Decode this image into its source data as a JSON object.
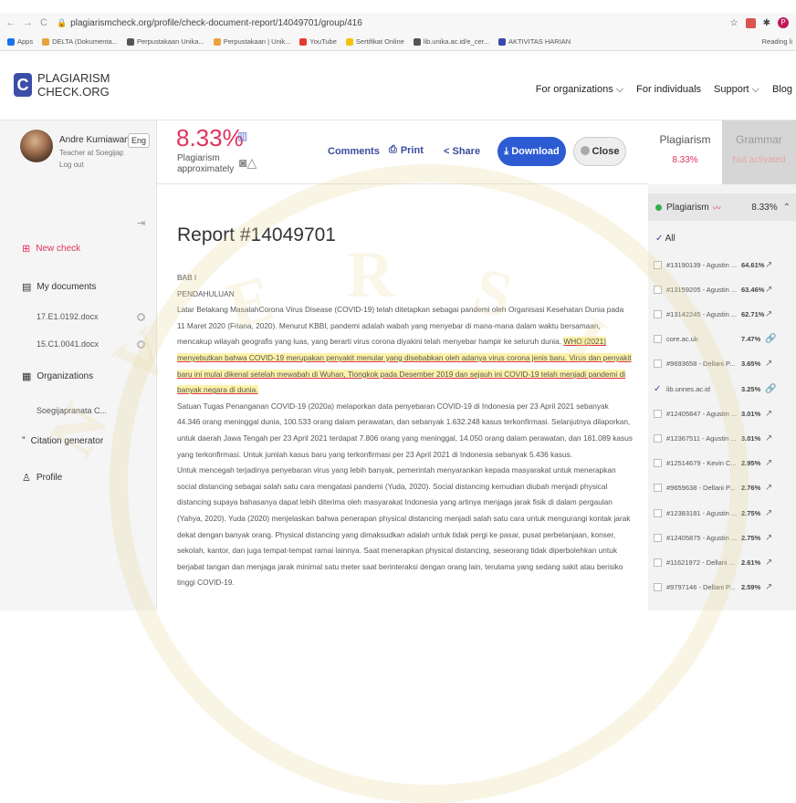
{
  "browser": {
    "url": "plagiarismcheck.org/profile/check-document-report/14049701/group/416",
    "nav_back": "←",
    "nav_forward": "→",
    "nav_reload": "C",
    "bookmarks": [
      "Apps",
      "DELTA (Dokumenta...",
      "Perpustakaan Unika...",
      "Perpustakaan | Unik...",
      "YouTube",
      "Sertifikat Online",
      "lib.unika.ac.id/e_cer...",
      "AKTIVITAS HARIAN"
    ],
    "reading_list": "Reading li"
  },
  "site": {
    "logo_line1": "PLAGIARISM",
    "logo_line2": "CHECK.ORG",
    "logo_letter": "C",
    "nav": [
      "For organizations ⌵",
      "For individuals",
      "Support ⌵",
      "Blog"
    ]
  },
  "user": {
    "name": "Andre Kurniawan",
    "role": "Teacher at Soegijapra...",
    "logout": "Log out",
    "lang": "Eng"
  },
  "score": {
    "value": "8.33%",
    "label_line1": "Plagiarism",
    "label_line2": "approximately"
  },
  "actions": {
    "comments": "Comments",
    "print": "Print",
    "share": "Share",
    "download": "Download",
    "close": "Close"
  },
  "tabs": {
    "plagiarism": "Plagiarism",
    "plagiarism_value": "8.33%",
    "grammar": "Grammar",
    "grammar_value": "Not activated"
  },
  "sidebar": {
    "collapse": "⇥",
    "new_check": "New check",
    "my_documents": "My documents",
    "docs": [
      {
        "name": "17.E1.0192.docx"
      },
      {
        "name": "15.C1.0041.docx"
      }
    ],
    "organizations": "Organizations",
    "org_name": "Soegijapranata C...",
    "citation": "Citation generator",
    "profile": "Profile"
  },
  "report": {
    "title": "Report #14049701",
    "bab": "BAB I",
    "section": "PENDAHULUAN",
    "p1": "Latar Belakang MasalahCorona Virus Disease (COVID-19) telah ditetapkan sebagai pandemi oleh Organisasi Kesehatan Dunia pada 11 Maret 2020 (Friana, 2020). Menurut KBBI, pandemi adalah wabah yang menyebar di mana-mana dalam waktu bersamaan, mencakup wilayah geografis yang luas, yang berarti virus corona diyakini telah menyebar hampir ke seluruh dunia.",
    "p1_hl": "WHO (2021) menyebutkan bahwa COVID-19 merupakan penyakit menular yang disebabkan oleh adanya virus corona jenis baru. Virus dan penyakit baru ini mulai dikenal setelah mewabah di Wuhan, Tiongkok pada Desember 2019 dan sejauh ini COVID-19 telah menjadi pandemi di banyak negara di dunia.",
    "p2": "Satuan Tugas Penanganan COVID-19 (2020a) melaporkan data penyebaran COVID-19 di Indonesia per 23 April 2021 sebanyak 44.346 orang meninggal dunia, 100.533 orang dalam perawatan, dan sebanyak 1.632.248 kasus terkonfirmasi. Selanjutnya dilaporkan, untuk daerah Jawa Tengah per 23 April 2021 terdapat 7.806 orang yang meninggal, 14.050 orang dalam perawatan, dan 181.089 kasus yang terkonfirmasi. Untuk jumlah kasus baru yang terkonfirmasi per 23 April 2021 di Indonesia sebanyak 5.436 kasus.",
    "p3": "Untuk mencegah terjadinya penyebaran virus yang lebih banyak, pemerintah menyarankan kepada masyarakat untuk menerapkan social distancing sebagai salah satu cara mengatasi pandemi (Yuda, 2020). Social distancing kemudian diubah menjadi physical distancing supaya bahasanya dapat lebih diterima oleh masyarakat Indonesia yang artinya menjaga jarak fisik di dalam pergaulan (Yahya, 2020). Yuda (2020) menjelaskan bahwa penerapan physical distancing menjadi salah satu cara untuk mengurangi kontak jarak dekat dengan banyak orang. Physical distancing yang dimaksudkan adalah untuk tidak pergi ke pasar, pusat perbelanjaan, konser, sekolah, kantor, dan juga tempat-tempat ramai lainnya. Saat menerapkan physical distancing, seseorang tidak diperbolehkan untuk berjabat tangan dan menjaga jarak minimal satu meter saat berinteraksi dengan orang lain, terutama yang sedang sakit atau berisiko tinggi COVID-19."
  },
  "panel": {
    "header_label": "Plagiarism",
    "header_value": "8.33%",
    "all_label": "All",
    "sources": [
      {
        "name": "#13190139 - Agustin ...",
        "pct": "64.61%",
        "checked": false,
        "link": "↗"
      },
      {
        "name": "#13159205 - Agustin ...",
        "pct": "63.46%",
        "checked": false,
        "link": "↗"
      },
      {
        "name": "#13142245 - Agustin ...",
        "pct": "62.71%",
        "checked": false,
        "link": "↗"
      },
      {
        "name": "core.ac.uk",
        "pct": "7.47%",
        "checked": false,
        "link": "🔗"
      },
      {
        "name": "#9693658 - Dellani P...",
        "pct": "3.65%",
        "checked": false,
        "link": "↗"
      },
      {
        "name": "lib.unnes.ac.id",
        "pct": "3.25%",
        "checked": true,
        "link": "🔗"
      },
      {
        "name": "#12405847 - Agustin ...",
        "pct": "3.01%",
        "checked": false,
        "link": "↗"
      },
      {
        "name": "#12367511 - Agustin ...",
        "pct": "3.01%",
        "checked": false,
        "link": "↗"
      },
      {
        "name": "#12514679 - Kevin C...",
        "pct": "2.95%",
        "checked": false,
        "link": "↗"
      },
      {
        "name": "#9659638 - Dellani P...",
        "pct": "2.76%",
        "checked": false,
        "link": "↗"
      },
      {
        "name": "#12383181 - Agustin ...",
        "pct": "2.75%",
        "checked": false,
        "link": "↗"
      },
      {
        "name": "#12405875 - Agustin ...",
        "pct": "2.75%",
        "checked": false,
        "link": "↗"
      },
      {
        "name": "#11621972 - Dellani ...",
        "pct": "2.61%",
        "checked": false,
        "link": "↗"
      },
      {
        "name": "#9797146 - Dellani P...",
        "pct": "2.59%",
        "checked": false,
        "link": "↗"
      }
    ]
  },
  "colors": {
    "accent": "#e0335d",
    "primary": "#2d5bd3",
    "highlight": "#fdf2a8"
  }
}
